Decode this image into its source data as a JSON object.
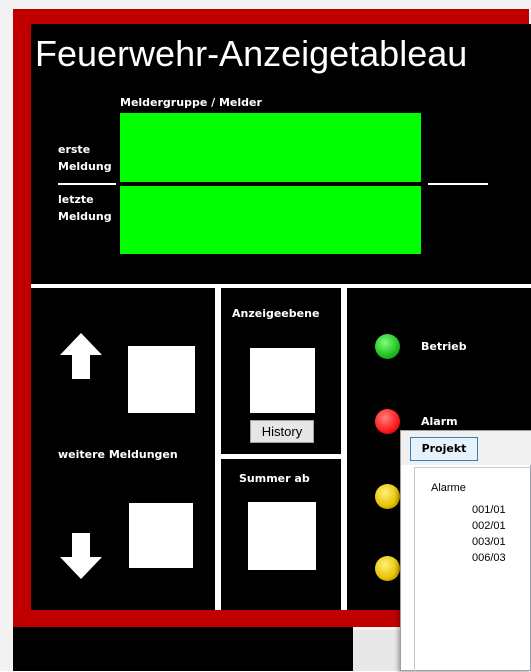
{
  "title": "Feuerwehr-Anzeigetableau",
  "display": {
    "group_label": "Meldergruppe / Melder",
    "first_label_line1": "erste",
    "first_label_line2": "Meldung",
    "last_label_line1": "letzte",
    "last_label_line2": "Meldung"
  },
  "controls": {
    "more_messages": "weitere Meldungen",
    "level_label": "Anzeigeebene",
    "history_button": "History",
    "buzzer_label": "Summer ab"
  },
  "status": {
    "operation": "Betrieb",
    "alarm": "Alarm"
  },
  "colors": {
    "frame": "#c00000",
    "panel": "#000000",
    "display_green": "#00ff00",
    "lamp_green": "#2ecc2e",
    "lamp_red": "#ff1a1a",
    "lamp_yellow": "#e6c200"
  },
  "popup": {
    "projekt_button": "Projekt",
    "list_header": "Alarme",
    "alarms": [
      "001/01",
      "002/01",
      "003/01",
      "006/03"
    ]
  }
}
